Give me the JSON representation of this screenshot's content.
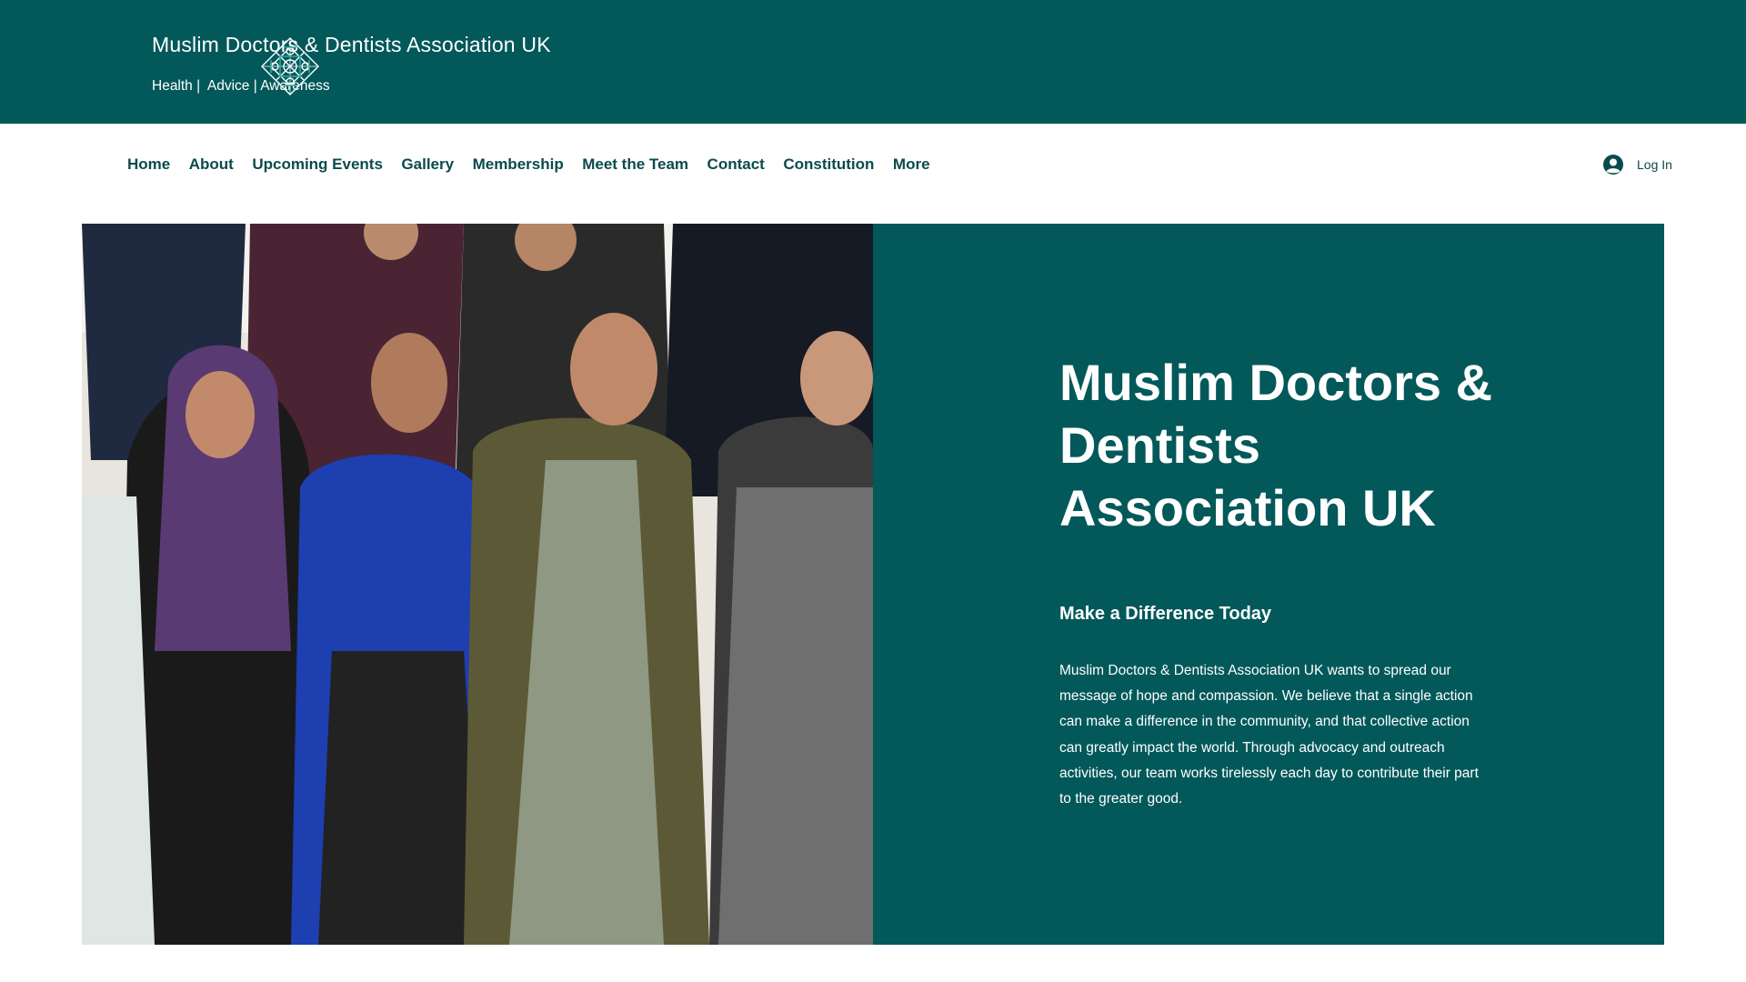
{
  "header": {
    "site_title": "Muslim Doctors & Dentists Association UK",
    "tagline": "Health |  Advice | Awareness",
    "logo_icon": "ornamental-knot-logo",
    "background_color": "#03585a"
  },
  "nav": {
    "items": [
      {
        "label": "Home"
      },
      {
        "label": "About"
      },
      {
        "label": "Upcoming Events"
      },
      {
        "label": "Gallery"
      },
      {
        "label": "Membership"
      },
      {
        "label": "Meet the Team"
      },
      {
        "label": "Contact"
      },
      {
        "label": "Constitution"
      },
      {
        "label": "More"
      }
    ],
    "text_color": "#0b4a4c"
  },
  "auth": {
    "login_label": "Log In",
    "icon": "user-avatar-icon"
  },
  "hero": {
    "title": "Muslim Doctors & Dentists Association UK",
    "subtitle": "Make a Difference Today",
    "body": "Muslim Doctors & Dentists Association UK wants to spread our message of hope and compassion. We believe that a single action can make a difference in the community, and that collective action can greatly impact the world. Through advocacy and outreach activities, our team works tirelessly each day to contribute their part to the greater good.",
    "panel_color": "#03585a",
    "photo": "group-photo-of-association-members"
  }
}
